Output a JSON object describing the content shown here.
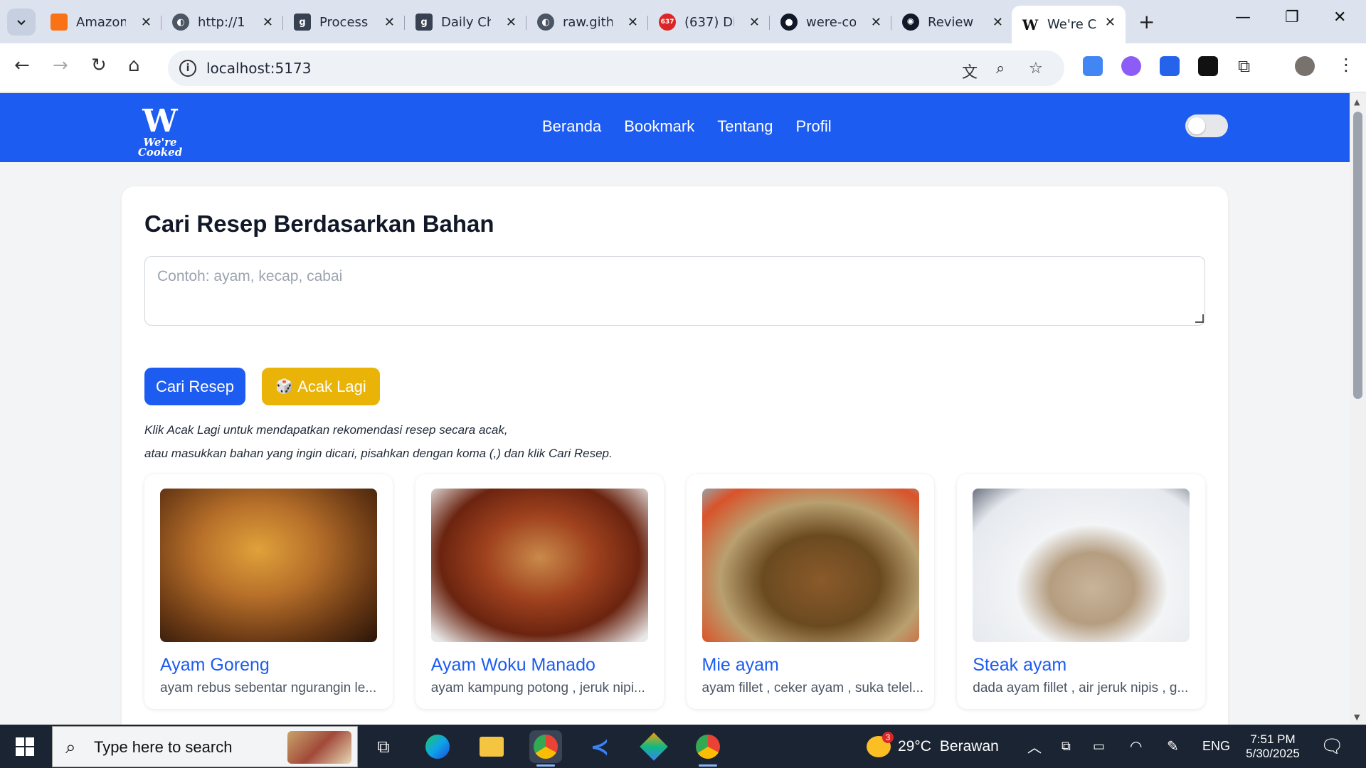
{
  "browser": {
    "tabs": [
      {
        "label": "Amazon",
        "fav": "#f97316"
      },
      {
        "label": "http://1",
        "fav": "#4b5563"
      },
      {
        "label": "Process",
        "fav": "#374151"
      },
      {
        "label": "Daily Ch",
        "fav": "#374151"
      },
      {
        "label": "raw.gith",
        "fav": "#4b5563"
      },
      {
        "label": "(637) Di",
        "fav": "#dc2626",
        "badge": "637"
      },
      {
        "label": "were-co",
        "fav": "#111827"
      },
      {
        "label": "Review",
        "fav": "#111827"
      },
      {
        "label": "We're C",
        "fav": "#111111",
        "active": true
      }
    ],
    "new_tab": "+",
    "url": "localhost:5173"
  },
  "app": {
    "logo_main": "W",
    "logo_sub": "We're Cooked",
    "nav": [
      "Beranda",
      "Bookmark",
      "Tentang",
      "Profil"
    ],
    "theme_toggle": "off"
  },
  "search": {
    "heading": "Cari Resep Berdasarkan Bahan",
    "placeholder": "Contoh: ayam, kecap, cabai",
    "search_button": "Cari Resep",
    "random_button": "Acak Lagi",
    "random_icon": "🎲",
    "hint_line1": "Klik Acak Lagi untuk mendapatkan rekomendasi resep secara acak,",
    "hint_line2": "atau masukkan bahan yang ingin dicari, pisahkan dengan koma (,) dan klik Cari Resep."
  },
  "recipes": [
    {
      "title": "Ayam Goreng",
      "desc": "ayam rebus sebentar ngurangin le..."
    },
    {
      "title": "Ayam Woku Manado",
      "desc": "ayam kampung potong , jeruk nipi..."
    },
    {
      "title": "Mie ayam",
      "desc": "ayam fillet , ceker ayam , suka telel..."
    },
    {
      "title": "Steak ayam",
      "desc": "dada ayam fillet , air jeruk nipis , g..."
    }
  ],
  "taskbar": {
    "search_text": "Type here to search",
    "weather_temp": "29°C",
    "weather_text": "Berawan",
    "weather_badge": "3",
    "lang": "ENG",
    "time": "7:51 PM",
    "date": "5/30/2025"
  }
}
